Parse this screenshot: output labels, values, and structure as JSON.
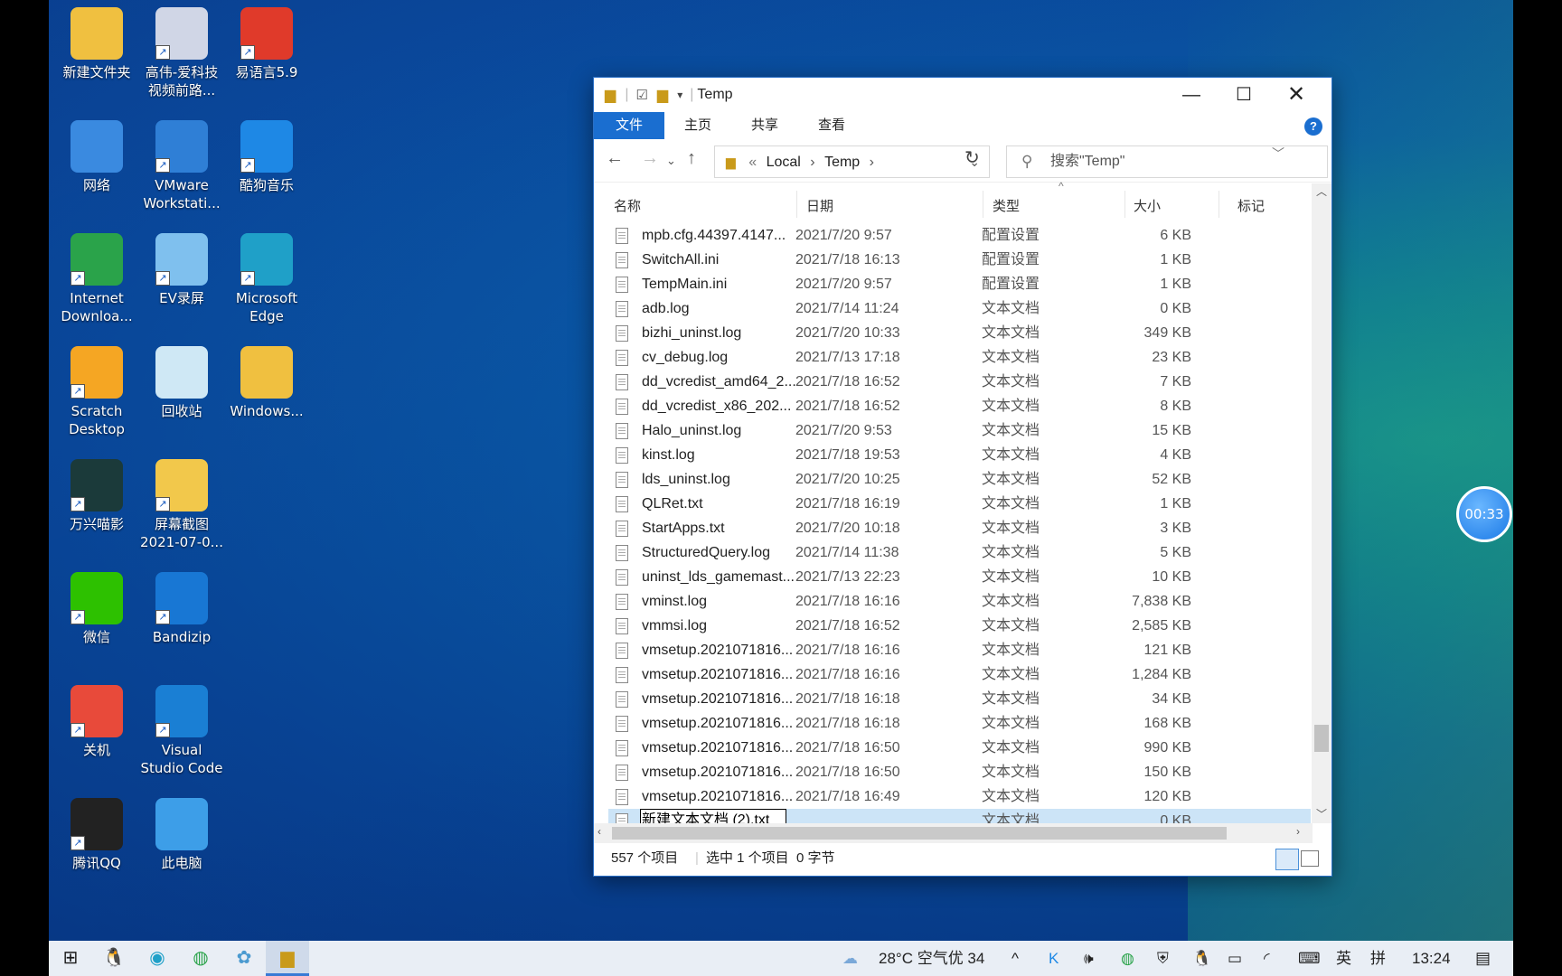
{
  "desktop": {
    "icons": [
      {
        "label": "新建文件夹",
        "icon": "folder-icon",
        "color": "#f0c040"
      },
      {
        "label": "高伟-爱科技视频前路...",
        "icon": "video-thumbnail-icon",
        "color": "#d0d6e6"
      },
      {
        "label": "易语言5.9",
        "icon": "yiyuyan-icon",
        "color": "#e03a2a"
      },
      {
        "label": "网络",
        "icon": "network-icon",
        "color": "#3a8ae0"
      },
      {
        "label": "VMware Workstati...",
        "icon": "vmware-icon",
        "color": "#2f7fd6"
      },
      {
        "label": "酷狗音乐",
        "icon": "kugou-music-icon",
        "color": "#1e88e5"
      },
      {
        "label": "Internet Downloa...",
        "icon": "internet-download-icon",
        "color": "#2aa34a"
      },
      {
        "label": "EV录屏",
        "icon": "ev-recorder-icon",
        "color": "#7fc0ee"
      },
      {
        "label": "Microsoft Edge",
        "icon": "edge-icon",
        "color": "#1fa0c8"
      },
      {
        "label": "Scratch Desktop",
        "icon": "scratch-icon",
        "color": "#f5a623"
      },
      {
        "label": "回收站",
        "icon": "recycle-bin-icon",
        "color": "#cfe8f5"
      },
      {
        "label": "Windows...",
        "icon": "folder-icon",
        "color": "#f0c040"
      },
      {
        "label": "万兴喵影",
        "icon": "filmora-icon",
        "color": "#1b3a3a"
      },
      {
        "label": "屏幕截图 2021-07-0...",
        "icon": "screenshot-thumbnail-icon",
        "color": "#f2c84b"
      },
      {
        "label": "微信",
        "icon": "wechat-icon",
        "color": "#2dc100"
      },
      {
        "label": "Bandizip",
        "icon": "bandizip-icon",
        "color": "#1877d4"
      },
      {
        "label": "关机",
        "icon": "power-icon",
        "color": "#e84a3a"
      },
      {
        "label": "Visual Studio Code",
        "icon": "vscode-icon",
        "color": "#1a7fd4"
      },
      {
        "label": "腾讯QQ",
        "icon": "qq-penguin-icon",
        "color": "#222222"
      },
      {
        "label": "此电脑",
        "icon": "computer-icon",
        "color": "#3d9ee8"
      }
    ]
  },
  "explorer": {
    "title": "Temp",
    "ribbon_tabs": [
      "文件",
      "主页",
      "共享",
      "查看"
    ],
    "address": {
      "prefix": "«",
      "parts": [
        "Local",
        "Temp"
      ]
    },
    "search_placeholder": "搜索\"Temp\"",
    "columns": {
      "name": "名称",
      "date": "日期",
      "type": "类型",
      "size": "大小",
      "tag": "标记"
    },
    "files": [
      {
        "name": "mpb.cfg.44397.4147...",
        "date": "2021/7/20 9:57",
        "type": "配置设置",
        "size": "6 KB"
      },
      {
        "name": "SwitchAll.ini",
        "date": "2021/7/18 16:13",
        "type": "配置设置",
        "size": "1 KB"
      },
      {
        "name": "TempMain.ini",
        "date": "2021/7/20 9:57",
        "type": "配置设置",
        "size": "1 KB"
      },
      {
        "name": "adb.log",
        "date": "2021/7/14 11:24",
        "type": "文本文档",
        "size": "0 KB"
      },
      {
        "name": "bizhi_uninst.log",
        "date": "2021/7/20 10:33",
        "type": "文本文档",
        "size": "349 KB"
      },
      {
        "name": "cv_debug.log",
        "date": "2021/7/13 17:18",
        "type": "文本文档",
        "size": "23 KB"
      },
      {
        "name": "dd_vcredist_amd64_2...",
        "date": "2021/7/18 16:52",
        "type": "文本文档",
        "size": "7 KB"
      },
      {
        "name": "dd_vcredist_x86_202...",
        "date": "2021/7/18 16:52",
        "type": "文本文档",
        "size": "8 KB"
      },
      {
        "name": "Halo_uninst.log",
        "date": "2021/7/20 9:53",
        "type": "文本文档",
        "size": "15 KB"
      },
      {
        "name": "kinst.log",
        "date": "2021/7/18 19:53",
        "type": "文本文档",
        "size": "4 KB"
      },
      {
        "name": "lds_uninst.log",
        "date": "2021/7/20 10:25",
        "type": "文本文档",
        "size": "52 KB"
      },
      {
        "name": "QLRet.txt",
        "date": "2021/7/18 16:19",
        "type": "文本文档",
        "size": "1 KB"
      },
      {
        "name": "StartApps.txt",
        "date": "2021/7/20 10:18",
        "type": "文本文档",
        "size": "3 KB"
      },
      {
        "name": "StructuredQuery.log",
        "date": "2021/7/14 11:38",
        "type": "文本文档",
        "size": "5 KB"
      },
      {
        "name": "uninst_lds_gamemast...",
        "date": "2021/7/13 22:23",
        "type": "文本文档",
        "size": "10 KB"
      },
      {
        "name": "vminst.log",
        "date": "2021/7/18 16:16",
        "type": "文本文档",
        "size": "7,838 KB"
      },
      {
        "name": "vmmsi.log",
        "date": "2021/7/18 16:52",
        "type": "文本文档",
        "size": "2,585 KB"
      },
      {
        "name": "vmsetup.2021071816...",
        "date": "2021/7/18 16:16",
        "type": "文本文档",
        "size": "121 KB"
      },
      {
        "name": "vmsetup.2021071816...",
        "date": "2021/7/18 16:16",
        "type": "文本文档",
        "size": "1,284 KB"
      },
      {
        "name": "vmsetup.2021071816...",
        "date": "2021/7/18 16:18",
        "type": "文本文档",
        "size": "34 KB"
      },
      {
        "name": "vmsetup.2021071816...",
        "date": "2021/7/18 16:18",
        "type": "文本文档",
        "size": "168 KB"
      },
      {
        "name": "vmsetup.2021071816...",
        "date": "2021/7/18 16:50",
        "type": "文本文档",
        "size": "990 KB"
      },
      {
        "name": "vmsetup.2021071816...",
        "date": "2021/7/18 16:50",
        "type": "文本文档",
        "size": "150 KB"
      },
      {
        "name": "vmsetup.2021071816...",
        "date": "2021/7/18 16:49",
        "type": "文本文档",
        "size": "120 KB"
      }
    ],
    "rename_row": {
      "value": "新建文本文档 (2).txt",
      "date": "",
      "type": "文本文档",
      "size": "0 KB"
    },
    "status": {
      "count": "557 个项目",
      "selection": "选中 1 个项目  0 字节"
    }
  },
  "timer": "00:33",
  "taskbar": {
    "weather": "28°C 空气优 34",
    "ime_lang": "英",
    "ime_mode": "拼",
    "clock": "13:24"
  }
}
